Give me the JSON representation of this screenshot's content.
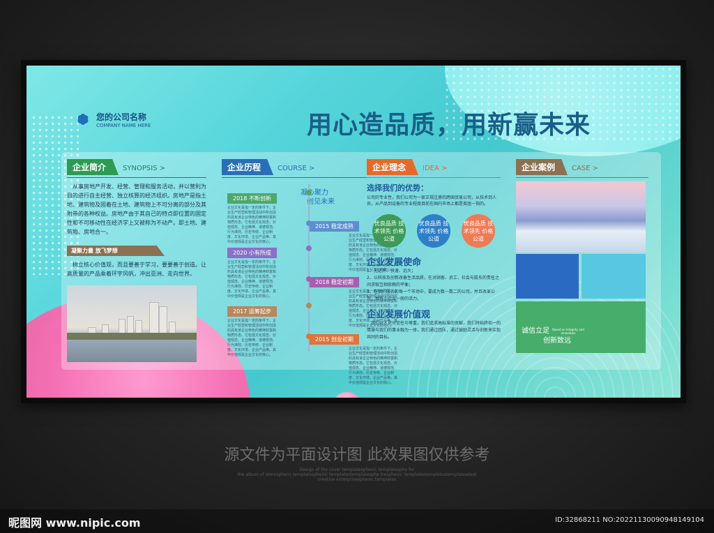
{
  "company": {
    "name": "您的公司名称",
    "sub": "COMPANY NAME HERE"
  },
  "headline": "用心造品质，用新赢未来",
  "about": {
    "tag": "企业简介",
    "tag_en": "SYNOPSIS >",
    "text": "从事房地产开发、经营、管理和服务活动，并以营利为目的进行自主经营、独立核算的经济组织。房地产是指土地、建筑物及固着在土地、建筑物上不可分离的部分及其附带的各种权益。房地产由于其自己的特点即位置的固定性和不可移动性在经济学上又被称为不动产。即土地、建筑物、房地合一。",
    "sub": "凝聚力量 放飞梦想",
    "text2": "树立核心价值观，而且要善于学习，要要善于创造。让高质量的产品乘着环宇风帆，冲出亚洲、走向世界。"
  },
  "history": {
    "tag": "企业历程",
    "tag_en": "COURSE >",
    "slogan1": "凝心聚力",
    "slogan2": "创见未来",
    "items": [
      {
        "label": "2018 不断创新",
        "text": "企业文化是指一定的条件下，企业生产经营和管理活动中所创造的具有该企业特色的精神财富和物质形态。它包括文化观念、价值观念、企业精神、道德规范、行为准则、历史传统、企业制度、文化环境、企业产品等。其中价值观是企业文化的核心。"
      },
      {
        "label": "2015 稳定成熟",
        "text": "企业文化是指一定的条件下，企业生产经营和管理活动中所创造的具有该企业特色的精神财富和物质形态。它包括文化观念、价值观念、企业精神、道德规范、行为准则、历史传统、企业制度、文化环境、企业产品等。其中价值观是企业文化的核心。"
      },
      {
        "label": "2020 小有所成",
        "text": "企业文化是指一定的条件下，企业生产经营和管理活动中所创造的具有该企业特色的精神财富和物质形态。它包括文化观念、价值观念、企业精神、道德规范、行为准则、历史传统、企业制度、文化环境、企业产品等。其中价值观是企业文化的核心。"
      },
      {
        "label": "2018 稳定初期",
        "text": "企业文化是指一定的条件下，企业生产经营和管理活动中所创造的具有该企业特色的精神财富和物质形态。它包括文化观念、价值观念、企业精神、道德规范、行为准则、历史传统、企业制度、文化环境、企业产品等。其中价值观是企业文化的核心。"
      },
      {
        "label": "2017 运筹起步",
        "text": "企业文化是指一定的条件下，企业生产经营和管理活动中所创造的具有该企业特色的精神财富和物质形态。它包括文化观念、价值观念、企业精神、道德规范、行为准则、历史传统、企业制度、文化环境、企业产品等。其中价值观是企业文化的核心。"
      },
      {
        "label": "2015 创业初期",
        "text": "企业文化是指一定的条件下，企业生产经营和管理活动中所创造的具有该企业特色的精神财富和物质形态。它包括文化观念、价值观念、企业精神、道德规范、行为准则、历史传统、企业制度、文化环境、企业产品等。其中价值观是企业文化的核心。"
      }
    ]
  },
  "idea": {
    "tag": "企业理念",
    "tag_en": "IDEA >",
    "h1": "选择我们的优势：",
    "text1": "公司的专业性，我们公司为一家正规注册的跨国贸易公司，从技术到人员，从产品到设备的专业程度目前在国内市场上都是首屈一指的。",
    "circles": [
      "优良品质 技术领先 价格公道",
      "优良品质 技术领先 价格公道",
      "优良品质 技术领先 价格公道"
    ],
    "h2": "企业发展使命",
    "mission": [
      "1、无边界、快速、远大；",
      "2、以科技及创新改善生活品质，在对顾客、员工、社会与股东的责任之间求取互相依赖的平衡；",
      "3、在我们服务的每一个市场中，要成为数一数二的公司，并且改革公司，拥有小企业一般的活力。"
    ],
    "h3": "企业发展价值观",
    "values": "我们对人充分信任与尊重，我们追求高标准的贡献，我们将始终如一的情操与我们的事业融为一体，我们通过团队，通过鼓励灵活与创新来实现共同的目标。"
  },
  "case": {
    "tag": "企业案例",
    "tag_en": "CASE >",
    "slogan1": "诚信立足",
    "slogan2": "创新致远",
    "slogan_en": "Based on integrity and innovation"
  },
  "watermark": {
    "main": "源文件为平面设计图  此效果图仅供参考",
    "lines": [
      "Design of the cover templatesphenic templatesphe for",
      "the album of atmospheric templatesphenic templatestemplatesphe tresphenic templatestemplatestemplatesdeet",
      "creative enterprisesphenic templates"
    ]
  },
  "footer": {
    "site": "昵图网 www.nipic.com",
    "id": "ID:32868211 NO:20221130090948149104"
  },
  "colors": {
    "green": "#2e9a52",
    "blue": "#2a6fb5",
    "orange": "#e56a2a",
    "brown": "#8b7151"
  }
}
